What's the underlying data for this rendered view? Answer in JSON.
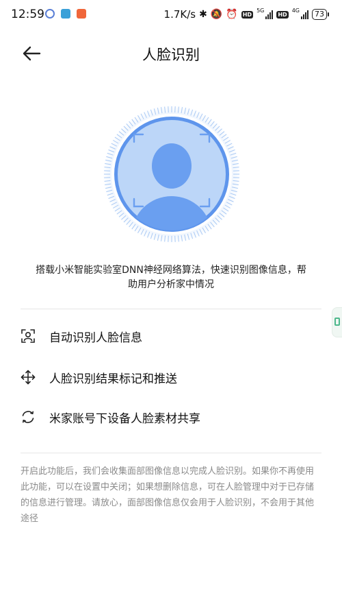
{
  "status_bar": {
    "time": "12:59",
    "speed": "1.7K/s",
    "net1": "5G",
    "net2": "4G",
    "hd": "HD",
    "battery": "73"
  },
  "header": {
    "title": "人脸识别"
  },
  "description": "搭载小米智能实验室DNN神经网络算法，快速识别图像信息，帮助用户分析家中情况",
  "features": [
    {
      "icon": "face-scan-icon",
      "label": "自动识别人脸信息"
    },
    {
      "icon": "move-arrows-icon",
      "label": "人脸识别结果标记和推送"
    },
    {
      "icon": "sync-icon",
      "label": "米家账号下设备人脸素材共享"
    }
  ],
  "notice": "开启此功能后，我们会收集面部图像信息以完成人脸识别。如果你不再使用此功能，可以在设置中关闭；如果想删除信息，可在人脸管理中对于已存储的信息进行管理。请放心，面部图像信息仅会用于人脸识别，不会用于其他途径",
  "colors": {
    "accent": "#5e95ec",
    "circle_fill": "#bcd6f8",
    "notice_text": "#8a8a8a"
  }
}
